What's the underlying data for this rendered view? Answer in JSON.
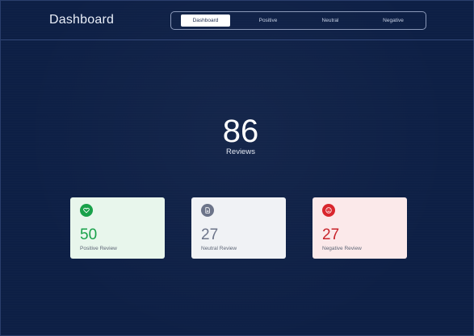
{
  "header": {
    "title": "Dashboard"
  },
  "tabs": [
    {
      "label": "Dashboard",
      "active": true
    },
    {
      "label": "Positive",
      "active": false
    },
    {
      "label": "Neutral",
      "active": false
    },
    {
      "label": "Negative",
      "active": false
    }
  ],
  "summary": {
    "total_count": "86",
    "total_label": "Reviews"
  },
  "cards": [
    {
      "icon": "heart-icon",
      "value": "50",
      "label": "Positive Review",
      "color": "#19a14a"
    },
    {
      "icon": "document-icon",
      "value": "27",
      "label": "Neutral Review",
      "color": "#6c7489"
    },
    {
      "icon": "sad-face-icon",
      "value": "27",
      "label": "Negative Review",
      "color": "#d9262d"
    }
  ],
  "colors": {
    "background": "#0d1f45",
    "active_tab": "#ffffff"
  }
}
